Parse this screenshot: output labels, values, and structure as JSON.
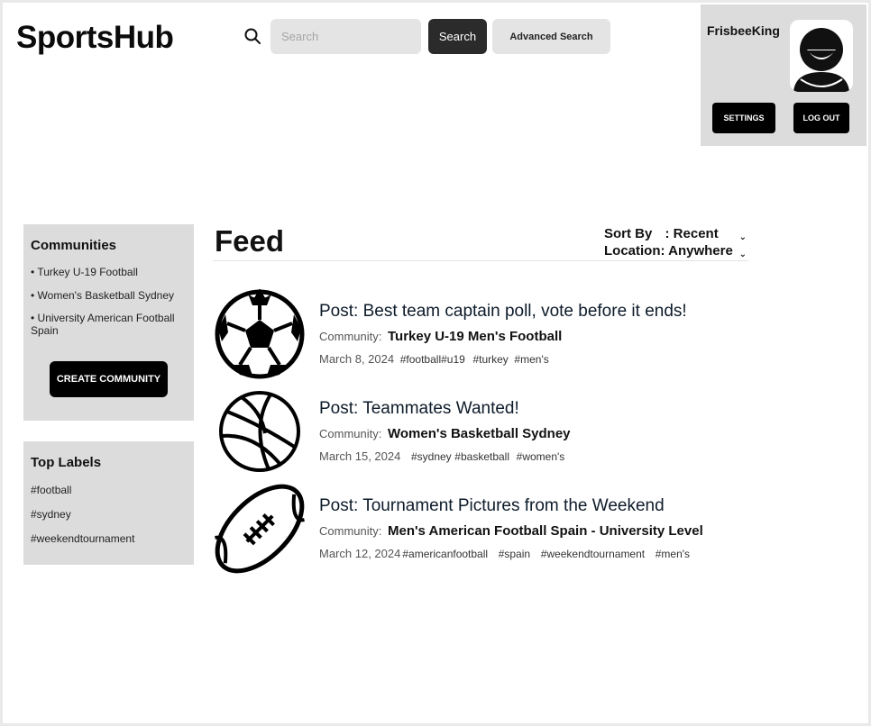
{
  "header": {
    "logo": "SportsHub",
    "search_placeholder": "Search",
    "search_button": "Search",
    "advanced_search_button": "Advanced Search"
  },
  "user": {
    "name": "FrisbeeKing",
    "settings_button": "SETTINGS",
    "logout_button": "LOG OUT"
  },
  "communities": {
    "title": "Communities",
    "items": [
      "• Turkey U-19 Football",
      "• Women's Basketball Sydney",
      "• University American Football Spain"
    ],
    "create_button": "CREATE COMMUNITY"
  },
  "top_labels": {
    "title": "Top Labels",
    "items": [
      "#football",
      "#sydney",
      "#weekendtournament"
    ]
  },
  "feed": {
    "title": "Feed",
    "sort_label": "Sort By",
    "sort_value": ": Recent",
    "location_label": "Location:",
    "location_value": "Anywhere",
    "posts": [
      {
        "icon": "soccer-ball-icon",
        "title": "Post: Best team captain poll, vote before it ends!",
        "community_label": "Community:",
        "community": "Turkey U-19 Men's Football",
        "date": "March 8, 2024",
        "tags": [
          "#football",
          "#u19",
          "#turkey",
          "#men's"
        ]
      },
      {
        "icon": "basketball-icon",
        "title": "Post: Teammates Wanted!",
        "community_label": "Community:",
        "community": "Women's Basketball Sydney",
        "date": "March 15, 2024",
        "tags": [
          "#sydney",
          "#basketball",
          "#women's"
        ]
      },
      {
        "icon": "american-football-icon",
        "title": "Post: Tournament Pictures from the Weekend",
        "community_label": "Community:",
        "community": "Men's American Football Spain - University Level",
        "date": "March 12, 2024",
        "tags": [
          "#americanfootball",
          "#spain",
          "#weekendtournament",
          "#men's"
        ]
      }
    ]
  },
  "colors": {
    "panel_bg": "#dcdcdc",
    "button_dark": "#000000",
    "search_button": "#2b2b2b",
    "input_bg": "#e4e4e4"
  }
}
